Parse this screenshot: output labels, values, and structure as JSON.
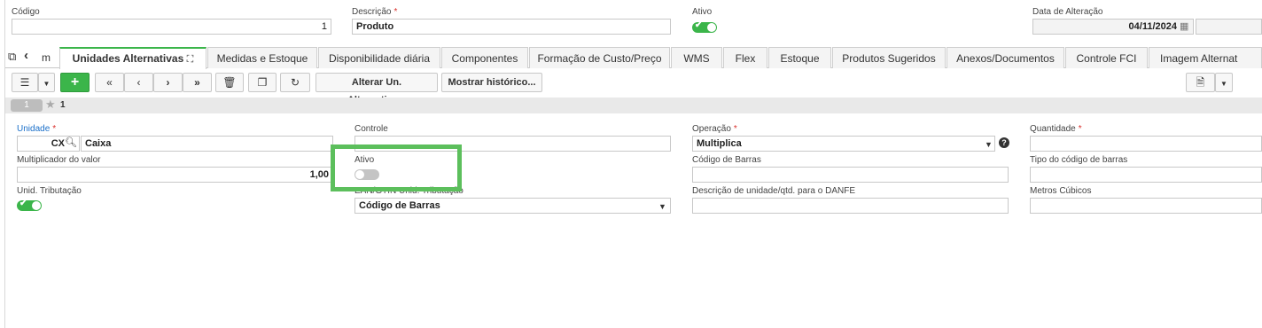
{
  "header": {
    "codigo_label": "Código",
    "codigo_value": "1",
    "descricao_label": "Descrição",
    "descricao_value": "Produto",
    "ativo_label": "Ativo",
    "data_alteracao_label": "Data de Alteração",
    "data_alteracao_value": "04/11/2024",
    "required_mark": "*"
  },
  "tabs": {
    "partial_label": "m",
    "items": [
      "Unidades Alternativas",
      "Medidas e Estoque",
      "Disponibilidade diária",
      "Componentes",
      "Formação de Custo/Preço",
      "WMS",
      "Flex",
      "Estoque",
      "Produtos Sugeridos",
      "Anexos/Documentos",
      "Controle FCI",
      "Imagem Alternat"
    ]
  },
  "toolbar": {
    "alterar_label": "Alterar Un. Alternativa...",
    "historico_label": "Mostrar histórico...",
    "add_label": "+"
  },
  "record": {
    "page_number": "1",
    "favorite_count": "1"
  },
  "form": {
    "unidade_label": "Unidade",
    "unidade_code": "CX",
    "unidade_desc": "Caixa",
    "controle_label": "Controle",
    "controle_value": "",
    "operacao_label": "Operação",
    "operacao_value": "Multiplica",
    "quantidade_label": "Quantidade",
    "quantidade_value": "",
    "multiplicador_label": "Multiplicador do valor",
    "multiplicador_value": "1,00",
    "ativo_label": "Ativo",
    "codigo_barras_label": "Código de Barras",
    "codigo_barras_value": "",
    "tipo_codigo_label": "Tipo do código de barras",
    "tipo_codigo_value": "",
    "unid_tributacao_label": "Unid. Tributação",
    "ean_label": "EAN/GTIN Unid. Tributação",
    "ean_value": "Código de Barras",
    "danfe_label": "Descrição de unidade/qtd. para o DANFE",
    "danfe_value": "",
    "metros_label": "Metros Cúbicos",
    "metros_value": ""
  },
  "colors": {
    "accent": "#3bb54a",
    "highlight": "#5cbf5c",
    "required": "#d9302c",
    "link": "#1a6fc9"
  }
}
